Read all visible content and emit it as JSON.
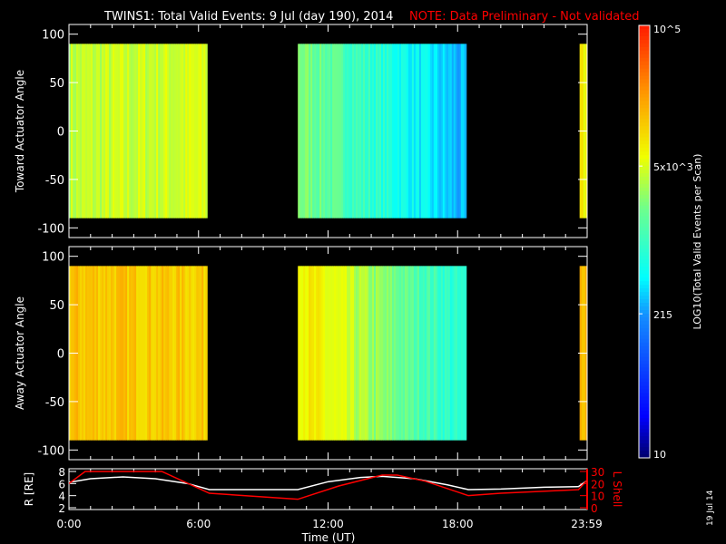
{
  "title": {
    "main": "TWINS1: Total Valid Events:  9 Jul (day 190), 2014",
    "note": "NOTE: Data Preliminary - Not validated",
    "note_color": "#ff0000"
  },
  "side_date": "19 Jul 14",
  "chart_data": [
    {
      "type": "heatmap",
      "ylabel": "Toward Actuator Angle",
      "ylim": [
        -110,
        110
      ],
      "yticks": [
        "100",
        "50",
        "0",
        "-50",
        "-100"
      ],
      "ytick_values": [
        100,
        50,
        0,
        -50,
        -100
      ],
      "data_yrange": [
        -90,
        90
      ],
      "xlim_hours": [
        0,
        24
      ],
      "blocks": [
        {
          "start_h": 0.0,
          "end_h": 6.4,
          "counts_start": 4000,
          "counts_end": 5000
        },
        {
          "start_h": 10.6,
          "end_h": 18.4,
          "counts_start": 2500,
          "counts_end": 250
        },
        {
          "start_h": 23.65,
          "end_h": 24.0,
          "counts_start": 7000,
          "counts_end": 7000
        }
      ]
    },
    {
      "type": "heatmap",
      "ylabel": "Away Actuator Angle",
      "ylim": [
        -110,
        110
      ],
      "yticks": [
        "100",
        "50",
        "0",
        "-50",
        "-100"
      ],
      "ytick_values": [
        100,
        50,
        0,
        -50,
        -100
      ],
      "data_yrange": [
        -90,
        90
      ],
      "xlim_hours": [
        0,
        24
      ],
      "blocks": [
        {
          "start_h": 0.0,
          "end_h": 6.4,
          "counts_start": 14000,
          "counts_end": 12000
        },
        {
          "start_h": 10.6,
          "end_h": 18.4,
          "counts_start": 9000,
          "counts_end": 700
        },
        {
          "start_h": 23.65,
          "end_h": 24.0,
          "counts_start": 18000,
          "counts_end": 18000
        }
      ]
    },
    {
      "type": "line",
      "xlabel": "Time (UT)",
      "xticks": [
        "0:00",
        "6:00",
        "12:00",
        "18:00",
        "23:59"
      ],
      "xtick_hours": [
        0,
        6,
        12,
        18,
        23.98
      ],
      "ylabel_left": "R [RE]",
      "ylim_left": [
        2,
        8
      ],
      "yticks_left": [
        "8",
        "6",
        "4",
        "2"
      ],
      "ylabel_right": "L Shell",
      "ylim_right": [
        0,
        30
      ],
      "yticks_right": [
        "30",
        "20",
        "10",
        "0"
      ],
      "series": [
        {
          "axis": "left",
          "color": "#ffffff",
          "x": [
            0,
            1,
            2.5,
            4,
            5.5,
            6.5,
            10.6,
            12,
            13.5,
            14.5,
            16,
            17.5,
            18.5,
            20,
            22,
            23.6,
            24
          ],
          "y": [
            6.2,
            6.8,
            7.1,
            6.8,
            6.0,
            5.0,
            5.0,
            6.3,
            7.0,
            7.2,
            6.8,
            5.8,
            5.0,
            5.1,
            5.4,
            5.5,
            6.5
          ]
        },
        {
          "axis": "right",
          "color": "#ff0000",
          "x": [
            0,
            0.75,
            4.3,
            6.5,
            10.6,
            12.5,
            14.5,
            15.2,
            16.5,
            18.5,
            20,
            23.6,
            24
          ],
          "y": [
            20,
            30,
            30,
            12,
            7,
            18,
            27,
            27,
            22,
            10,
            12,
            15,
            23
          ]
        }
      ]
    },
    {
      "type": "colorbar",
      "label": "LOG10(Total Valid Events per Scan)",
      "scale": "log",
      "range": [
        10,
        100000
      ],
      "ticks": [
        "10^5",
        "5x10^3",
        "215",
        "10"
      ],
      "tick_values": [
        100000,
        5000,
        215,
        10
      ]
    }
  ]
}
